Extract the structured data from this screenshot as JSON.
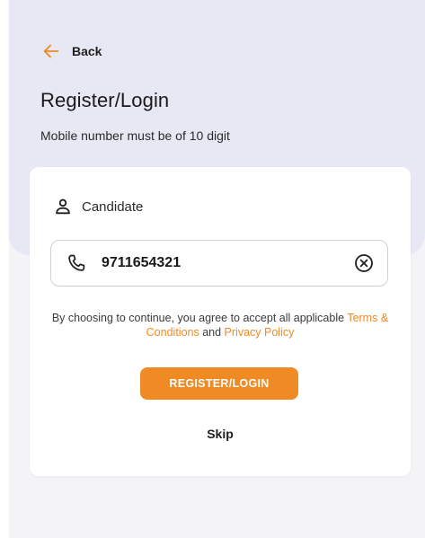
{
  "header": {
    "back_label": "Back",
    "title": "Register/Login",
    "subtitle": "Mobile number must be of 10 digit"
  },
  "form": {
    "role_label": "Candidate",
    "phone_value": "9711654321",
    "consent_prefix": "By choosing to continue, you agree to accept all applicable ",
    "terms_link": "Terms & Conditions",
    "consent_middle": " and ",
    "privacy_link": "Privacy Policy",
    "submit_label": "REGISTER/LOGIN",
    "skip_label": "Skip"
  },
  "icons": {
    "back": "arrow-left-icon",
    "role": "person-icon",
    "phone": "phone-icon",
    "clear": "close-circle-icon"
  },
  "colors": {
    "accent": "#f08a24",
    "hero_background": "#e8e8f5",
    "page_background": "#f4f4f7",
    "card_background": "#ffffff"
  }
}
